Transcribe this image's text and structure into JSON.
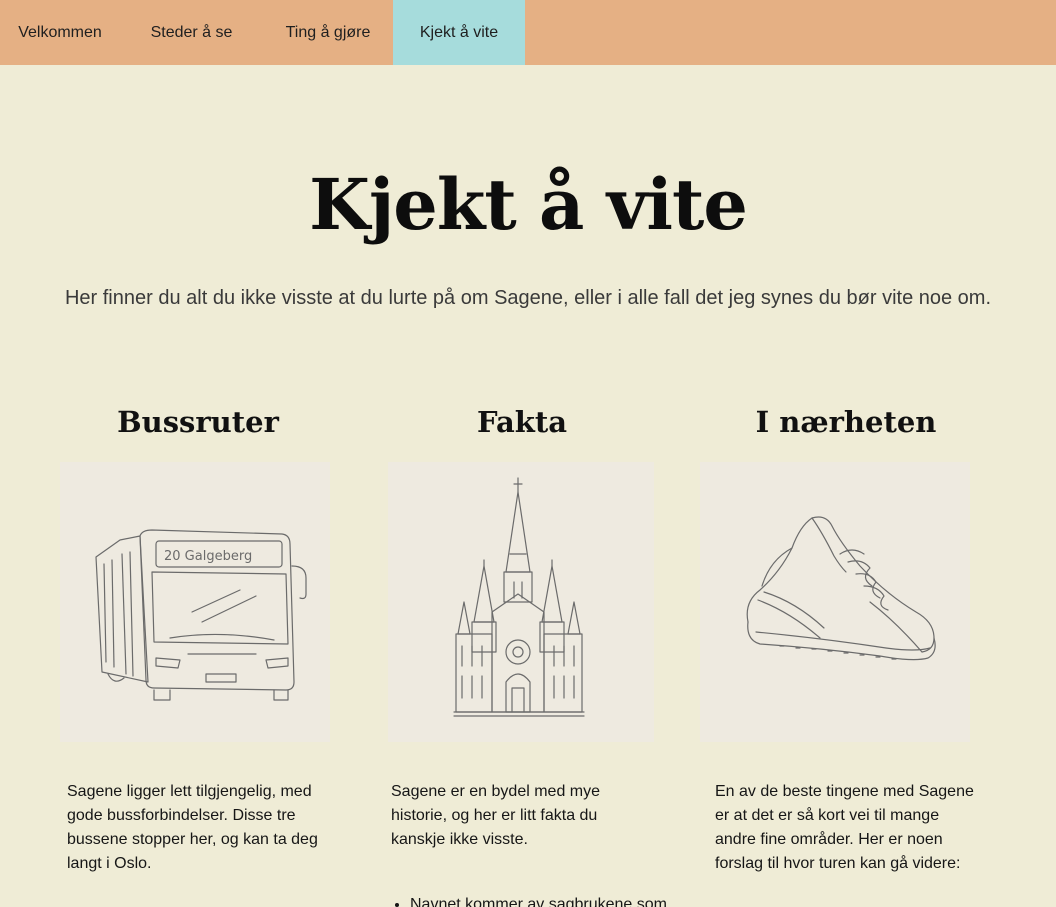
{
  "nav": {
    "items": [
      {
        "label": "Velkommen",
        "active": false
      },
      {
        "label": "Steder å se",
        "active": false
      },
      {
        "label": "Ting å gjøre",
        "active": false
      },
      {
        "label": "Kjekt å vite",
        "active": true
      }
    ]
  },
  "hero": {
    "title": "Kjekt å vite",
    "intro": "Her finner du alt du ikke visste at du lurte på om Sagene, eller i alle fall det jeg synes du bør vite noe om."
  },
  "sections": {
    "bus": {
      "title": "Bussruter",
      "icon": "bus-illustration",
      "sign_text": "20 Galgeberg",
      "text": "Sagene ligger lett tilgjengelig, med gode bussforbindelser. Disse tre bussene stopper her, og kan ta deg langt i Oslo."
    },
    "facts": {
      "title": "Fakta",
      "icon": "church-illustration",
      "text": "Sagene er en bydel med mye historie, og her er litt fakta du kanskje ikke visste.",
      "list": [
        "Navnet kommer av sagbrukene som lå"
      ]
    },
    "nearby": {
      "title": "I nærheten",
      "icon": "sneaker-illustration",
      "text": "En av de beste tingene med Sagene er at det er så kort vei til mange andre fine områder. Her er noen forslag til hvor turen kan gå videre:"
    }
  },
  "colors": {
    "background": "#efecd6",
    "nav": "#e5b084",
    "nav_active": "#a6dcdc"
  }
}
